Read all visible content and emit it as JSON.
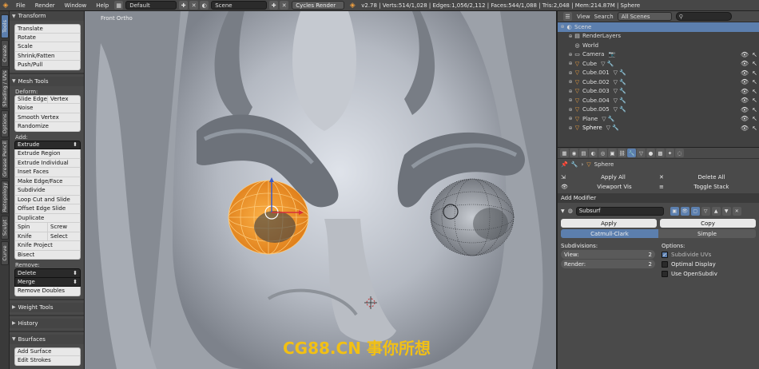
{
  "topbar": {
    "menus": [
      "File",
      "Render",
      "Window",
      "Help"
    ],
    "screen_layout": "Default",
    "scene": "Scene",
    "render_engine": "Cycles Render",
    "stats": "v2.78 | Verts:514/1,028 | Edges:1,056/2,112 | Faces:544/1,088 | Tris:2,048 | Mem:214.87M | Sphere"
  },
  "side_tabs": [
    "Tools",
    "Create",
    "Shading / UVs",
    "Options",
    "Grease Pencil",
    "Retopology",
    "Sculpt",
    "Curve"
  ],
  "toolshelf": {
    "transform": {
      "title": "Transform",
      "items": [
        "Translate",
        "Rotate",
        "Scale",
        "Shrink/Fatten",
        "Push/Pull"
      ]
    },
    "mesh_tools": {
      "title": "Mesh Tools",
      "deform_label": "Deform:",
      "slide_edge": "Slide Edge",
      "vertex": "Vertex",
      "noise": "Noise",
      "smooth_vertex": "Smooth Vertex",
      "randomize": "Randomize",
      "add_label": "Add:",
      "extrude_select": "Extrude",
      "add_items": [
        "Extrude Region",
        "Extrude Individual",
        "Inset Faces",
        "Make Edge/Face",
        "Subdivide",
        "Loop Cut and Slide",
        "Offset Edge Slide",
        "Duplicate"
      ],
      "spin": "Spin",
      "screw": "Screw",
      "knife": "Knife",
      "select": "Select",
      "knife_project": "Knife Project",
      "bisect": "Bisect",
      "remove_label": "Remove:",
      "delete_select": "Delete",
      "merge_select": "Merge",
      "remove_doubles": "Remove Doubles"
    },
    "weight_tools": "Weight Tools",
    "history": "History",
    "bsurfaces": "Bsurfaces",
    "add_surface": "Add Surface",
    "edit_strokes": "Edit Strokes"
  },
  "viewport": {
    "title": "Front Ortho",
    "watermark": "CG88.CN 事你所想"
  },
  "outliner": {
    "view": "View",
    "search": "Search",
    "scenes_select": "All Scenes",
    "rows": [
      {
        "name": "Scene",
        "icon": "scene-icon",
        "selected": true,
        "level": 0
      },
      {
        "name": "RenderLayers",
        "icon": "renderlayers-icon",
        "level": 1
      },
      {
        "name": "World",
        "icon": "world-icon",
        "level": 1
      },
      {
        "name": "Camera",
        "icon": "camera-icon",
        "level": 1
      },
      {
        "name": "Cube",
        "icon": "mesh-icon",
        "level": 1
      },
      {
        "name": "Cube.001",
        "icon": "mesh-icon",
        "level": 1
      },
      {
        "name": "Cube.002",
        "icon": "mesh-icon",
        "level": 1
      },
      {
        "name": "Cube.003",
        "icon": "mesh-icon",
        "level": 1
      },
      {
        "name": "Cube.004",
        "icon": "mesh-icon",
        "level": 1
      },
      {
        "name": "Cube.005",
        "icon": "mesh-icon",
        "level": 1
      },
      {
        "name": "Plane",
        "icon": "mesh-icon",
        "level": 1
      },
      {
        "name": "Sphere",
        "icon": "mesh-icon",
        "level": 1
      }
    ]
  },
  "properties": {
    "object_name": "Sphere",
    "apply_all": "Apply All",
    "delete_all": "Delete All",
    "viewport_vis": "Viewport Vis",
    "toggle_stack": "Toggle Stack",
    "add_modifier": "Add Modifier",
    "modifier_name": "Subsurf",
    "apply": "Apply",
    "copy": "Copy",
    "catmull_clark": "Catmull-Clark",
    "simple": "Simple",
    "subdivisions_label": "Subdivisions:",
    "view_label": "View:",
    "view_value": "2",
    "render_label": "Render:",
    "render_value": "2",
    "options_label": "Options:",
    "subdivide_uvs": "Subdivide UVs",
    "optimal_display": "Optimal Display",
    "use_opensubdiv": "Use OpenSubdiv"
  },
  "colors": {
    "accent": "#5c7fae",
    "selected_orange": "#f0a040",
    "watermark": "#f2c014"
  }
}
